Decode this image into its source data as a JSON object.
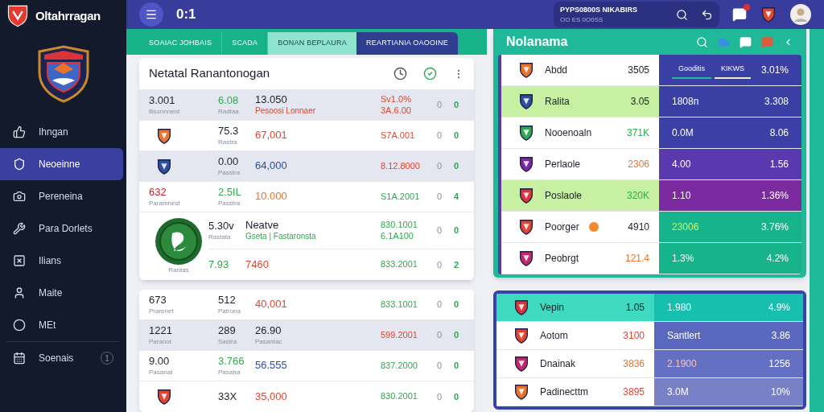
{
  "brand": {
    "name": "Oltahrragan"
  },
  "sidebar": {
    "items": [
      {
        "label": "Ihngan",
        "selected": false
      },
      {
        "label": "Neoeinne",
        "selected": true
      },
      {
        "label": "Pereneina",
        "selected": false
      },
      {
        "label": "Para Dorlets",
        "selected": false
      },
      {
        "label": "Ilians",
        "selected": false
      },
      {
        "label": "Maite",
        "selected": false
      },
      {
        "label": "MEt",
        "selected": false
      },
      {
        "label": "Soenais",
        "selected": false,
        "badge": "1"
      }
    ]
  },
  "header": {
    "title": "0:1",
    "search": {
      "line1": "PYPS0800S NIKABIRS",
      "line2": "OO ES 0O0SS"
    }
  },
  "tabs": [
    {
      "label": "SOAIAC JOHBAIS",
      "selected": false
    },
    {
      "label": "SCADA",
      "selected": false
    },
    {
      "label": "BONAN BEPLAURA",
      "selected": true
    },
    {
      "label": "REARTIANIA OAOOINE",
      "selected": false,
      "kind": "dark"
    }
  ],
  "card": {
    "title": "Netatal Ranantonogan",
    "rows": [
      {
        "shaded": true,
        "first": {
          "kind": "text",
          "value": "3.001",
          "sub": "Bsonnnent",
          "color": "#1c1f2a"
        },
        "second": {
          "value": "6.08",
          "sub": "Radtaa",
          "color": "#2fa84f"
        },
        "third": {
          "value": "13.050",
          "caption": {
            "text": "Pesoosi Lonnaer",
            "color": "#e0452f"
          },
          "color": "#1c1f2a"
        },
        "amount": {
          "lines": [
            "Sv1.0%",
            "3A.6.00"
          ],
          "color": "#e0452f"
        },
        "a": "0",
        "b": "0"
      },
      {
        "shaded": false,
        "first": {
          "kind": "logo"
        },
        "second": {
          "value": "75.3",
          "sub": "Rastra",
          "color": "#1c1f2a"
        },
        "third": {
          "value": "67,001",
          "color": "#e0452f"
        },
        "amount": {
          "lines": [
            "S7A.001"
          ],
          "color": "#e0452f"
        },
        "a": "0",
        "b": "0"
      },
      {
        "shaded": true,
        "first": {
          "kind": "logo"
        },
        "second": {
          "value": "0.00",
          "sub": "Passtra",
          "color": "#1c1f2a"
        },
        "third": {
          "value": "64,000",
          "color": "#2c4f9e"
        },
        "amount": {
          "lines": [
            "8.12.8000"
          ],
          "color": "#e0452f"
        },
        "a": "0",
        "b": "0"
      },
      {
        "shaded": false,
        "first": {
          "kind": "text",
          "value": "632",
          "sub": "Paramnest",
          "color": "#c0202a"
        },
        "second": {
          "value": "2.5IL",
          "sub": "Passtra",
          "color": "#2fa84f"
        },
        "third": {
          "value": "10.000",
          "color": "#e8742c"
        },
        "amount": {
          "lines": [
            "S1A.2001"
          ],
          "color": "#2fa84f"
        },
        "a": "0",
        "b": "4"
      },
      {
        "shaded": false,
        "first": {
          "kind": "biglogo",
          "sub": "Rantas"
        },
        "second": {
          "value": "5.30v",
          "sub": "Rastata",
          "color": "#1c1f2a"
        },
        "third": {
          "value": "Neatve",
          "caption": {
            "text": "Gseta | Fastaronsta",
            "color": "#2fa84f"
          },
          "color": "#1c1f2a"
        },
        "amount": {
          "lines": [
            "830.1001",
            "6.1A100"
          ],
          "color": "#2fa84f"
        },
        "a": "0",
        "b": "0"
      },
      {
        "shaded": false,
        "first": {
          "kind": "none"
        },
        "second": {
          "value": "7.93",
          "color": "#2fa84f"
        },
        "third": {
          "value": "7460",
          "color": "#e0452f"
        },
        "amount": {
          "lines": [
            "833.2001"
          ],
          "color": "#2fa84f"
        },
        "a": "0",
        "b": "2"
      }
    ]
  },
  "card2": {
    "rows": [
      {
        "shaded": false,
        "first": {
          "kind": "text",
          "value": "673",
          "sub": "Prarenet",
          "color": "#1c1f2a"
        },
        "second": {
          "value": "512",
          "sub": "Patrona",
          "color": "#1c1f2a"
        },
        "third": {
          "value": "40,001",
          "color": "#e0452f"
        },
        "amount": {
          "lines": [
            "833.1001"
          ],
          "color": "#2fa84f"
        },
        "a": "0",
        "b": "0"
      },
      {
        "shaded": true,
        "first": {
          "kind": "text",
          "value": "1221",
          "sub": "Paranot",
          "color": "#1c1f2a"
        },
        "second": {
          "value": "289",
          "sub": "Sastra",
          "color": "#1c1f2a"
        },
        "third": {
          "value": "26.90",
          "sub": "Pasantac",
          "color": "#1c1f2a"
        },
        "amount": {
          "lines": [
            "599.2001"
          ],
          "color": "#e0452f"
        },
        "a": "0",
        "b": "0"
      },
      {
        "shaded": false,
        "first": {
          "kind": "text",
          "value": "9.00",
          "sub": "Pasanat",
          "color": "#1c1f2a"
        },
        "second": {
          "value": "3.766",
          "sub": "Pasatra",
          "color": "#2fa84f"
        },
        "third": {
          "value": "56.555",
          "color": "#2c4f9e"
        },
        "amount": {
          "lines": [
            "837.2000"
          ],
          "color": "#2fa84f"
        },
        "a": "0",
        "b": "0"
      },
      {
        "shaded": false,
        "first": {
          "kind": "logo"
        },
        "second": {
          "value": "33X",
          "color": "#1c1f2a"
        },
        "third": {
          "value": "35,000",
          "color": "#e0452f"
        },
        "amount": {
          "lines": [
            "830.2001"
          ],
          "color": "#2fa84f"
        },
        "a": "0",
        "b": "0"
      }
    ]
  },
  "panel": {
    "title": "Nolanama",
    "subtabs": [
      {
        "label": "Gooditis",
        "selected": false
      },
      {
        "label": "KIKWS",
        "selected": true
      }
    ],
    "rows": [
      {
        "name": "Abdd",
        "score": {
          "value": "3505",
          "color": "#1c1f2a"
        },
        "highlighted": false,
        "color": "#3a3fa3",
        "percent": "3.01%"
      },
      {
        "name": "Ralita",
        "score": {
          "value": "3.05",
          "color": "#1c1f2a"
        },
        "highlighted": true,
        "color": "#3a3fa3",
        "stat": {
          "value": "1808n",
          "color": "#ffffff"
        },
        "percent": "3.308"
      },
      {
        "name": "Nooenoaln",
        "score": {
          "value": "371K",
          "color": "#2fa84f"
        },
        "highlighted": false,
        "color": "#3b3fa6",
        "stat": {
          "value": "0.0M",
          "color": "#ffffff"
        },
        "percent": "8.06"
      },
      {
        "name": "Perlaole",
        "score": {
          "value": "2306",
          "color": "#e8742c"
        },
        "highlighted": false,
        "color": "#5a38ad",
        "stat": {
          "value": "4.00",
          "color": "#ffffff"
        },
        "percent": "1.56"
      },
      {
        "name": "Poslaole",
        "score": {
          "value": "320K",
          "color": "#2fa84f"
        },
        "highlighted": true,
        "color": "#7b2a9f",
        "stat": {
          "value": "1.10",
          "color": "#ffffff"
        },
        "percent": "1.36%"
      },
      {
        "name": "Poorger",
        "score": {
          "value": "4910",
          "color": "#1c1f2a"
        },
        "highlighted": false,
        "color": "#17b38a",
        "badge": true,
        "stat": {
          "value": "23006",
          "color": "#c6f56a"
        },
        "percent": "3.76%"
      },
      {
        "name": "Peobrgt",
        "score": {
          "value": "121.4",
          "color": "#e8742c"
        },
        "highlighted": false,
        "color": "#17b38a",
        "stat": {
          "value": "1.3%",
          "color": "#ffffff"
        },
        "percent": "4.2%"
      }
    ]
  },
  "panel2": {
    "rows": [
      {
        "name": "Vepin",
        "score": {
          "value": "1.05",
          "color": "#1c1f2a"
        },
        "highlighted": true,
        "color": "#16bfae",
        "stat": {
          "value": "1.980",
          "color": "#ffffff"
        },
        "percent": "4.9%"
      },
      {
        "name": "Aotom",
        "score": {
          "value": "3100",
          "color": "#e0452f"
        },
        "highlighted": false,
        "color": "#5a68c0",
        "stat": {
          "value": "Santlert",
          "color": "#ffffff"
        },
        "percent": "3.86"
      },
      {
        "name": "Dnainak",
        "score": {
          "value": "3836",
          "color": "#e8742c"
        },
        "highlighted": false,
        "color": "#6470c4",
        "stat": {
          "value": "2.1900",
          "color": "#ffc2b8"
        },
        "percent": "1256"
      },
      {
        "name": "Padinecttm",
        "score": {
          "value": "3895",
          "color": "#e0452f"
        },
        "highlighted": false,
        "color": "#7880c8",
        "stat": {
          "value": "3.0M",
          "color": "#ffffff"
        },
        "percent": "10%"
      }
    ]
  }
}
